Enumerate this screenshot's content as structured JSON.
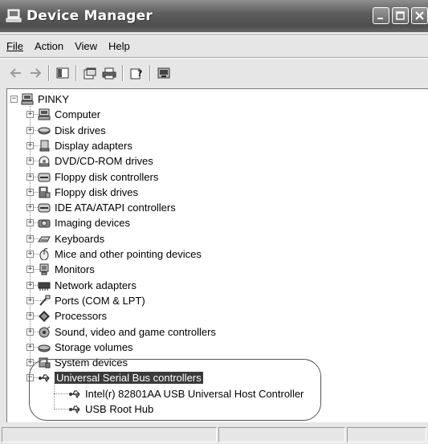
{
  "window": {
    "title": "Device Manager",
    "title_icon": "computer-icon",
    "controls": {
      "minimize": "_",
      "maximize": "□",
      "close": "✕"
    }
  },
  "menu": {
    "file": "File",
    "action": "Action",
    "view": "View",
    "help": "Help"
  },
  "toolbar": {
    "buttons": [
      {
        "name": "back-arrow-icon",
        "glyph": "←"
      },
      {
        "name": "forward-arrow-icon",
        "glyph": "→"
      },
      {
        "name": "show-hide-tree-icon",
        "glyph": "▣"
      },
      {
        "name": "properties-icon",
        "glyph": "🗗"
      },
      {
        "name": "print-icon",
        "glyph": "⎙"
      },
      {
        "name": "help-icon",
        "glyph": "?"
      },
      {
        "name": "scan-hardware-icon",
        "glyph": "▤"
      }
    ]
  },
  "tree": {
    "root": {
      "label": "PINKY",
      "icon": "computer-icon",
      "expanded": true
    },
    "items": [
      {
        "label": "Computer",
        "icon": "computer-icon",
        "expanded": false
      },
      {
        "label": "Disk drives",
        "icon": "disk-drive-icon",
        "expanded": false
      },
      {
        "label": "Display adapters",
        "icon": "display-adapter-icon",
        "expanded": false
      },
      {
        "label": "DVD/CD-ROM drives",
        "icon": "cdrom-icon",
        "expanded": false
      },
      {
        "label": "Floppy disk controllers",
        "icon": "floppy-controller-icon",
        "expanded": false
      },
      {
        "label": "Floppy disk drives",
        "icon": "floppy-drive-icon",
        "expanded": false
      },
      {
        "label": "IDE ATA/ATAPI controllers",
        "icon": "ide-controller-icon",
        "expanded": false
      },
      {
        "label": "Imaging devices",
        "icon": "camera-icon",
        "expanded": false
      },
      {
        "label": "Keyboards",
        "icon": "keyboard-icon",
        "expanded": false
      },
      {
        "label": "Mice and other pointing devices",
        "icon": "mouse-icon",
        "expanded": false
      },
      {
        "label": "Monitors",
        "icon": "monitor-icon",
        "expanded": false
      },
      {
        "label": "Network adapters",
        "icon": "network-adapter-icon",
        "expanded": false
      },
      {
        "label": "Ports (COM & LPT)",
        "icon": "port-icon",
        "expanded": false
      },
      {
        "label": "Processors",
        "icon": "processor-icon",
        "expanded": false
      },
      {
        "label": "Sound, video and game controllers",
        "icon": "sound-icon",
        "expanded": false
      },
      {
        "label": "Storage volumes",
        "icon": "storage-volume-icon",
        "expanded": false
      },
      {
        "label": "System devices",
        "icon": "system-devices-icon",
        "expanded": false
      },
      {
        "label": "Universal Serial Bus controllers",
        "icon": "usb-icon",
        "expanded": true,
        "selected": true
      }
    ],
    "usb_children": [
      {
        "label": "Intel(r) 82801AA USB Universal Host Controller",
        "icon": "usb-icon"
      },
      {
        "label": "USB Root Hub",
        "icon": "usb-icon"
      }
    ]
  },
  "colors": {
    "titlebar": "#5e5e5e",
    "window_bg": "#e6e6e6",
    "selection": "#3a3a3a",
    "tree_bg": "#ffffff"
  }
}
